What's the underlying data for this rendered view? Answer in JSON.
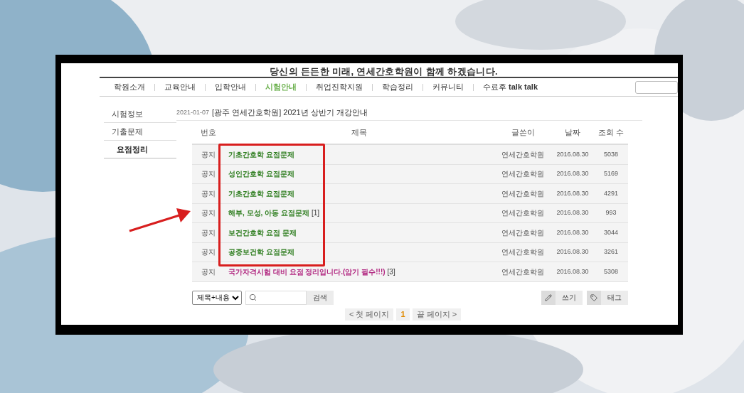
{
  "banner": {
    "slogan": "당신의 든든한 미래, 연세간호학원이 함께 하겠습니다."
  },
  "nav": [
    {
      "label": "학원소개",
      "selected": false
    },
    {
      "label": "교육안내",
      "selected": false
    },
    {
      "label": "입학안내",
      "selected": false
    },
    {
      "label": "시험안내",
      "selected": true
    },
    {
      "label": "취업진학지원",
      "selected": false
    },
    {
      "label": "학습정리",
      "selected": false
    },
    {
      "label": "커뮤니티",
      "selected": false
    },
    {
      "label": "수료후 **talk talk**",
      "selected": false
    }
  ],
  "sidebar": {
    "items": [
      {
        "label": "시험정보",
        "selected": false
      },
      {
        "label": "기출문제",
        "selected": false
      },
      {
        "label": "요점정리",
        "selected": true
      }
    ]
  },
  "notice": {
    "date": "2021-01-07",
    "title": "[광주 연세간호학원] 2021년 상반기 개강안내"
  },
  "table": {
    "columns": [
      "번호",
      "제목",
      "글쓴이",
      "날짜",
      "조회 수"
    ],
    "rows": [
      {
        "number": "공지",
        "title": "기초간호학 요점문제",
        "comments": "",
        "color": "#2e7d1f",
        "author": "연세간호학원",
        "date": "2016.08.30",
        "views": "5038"
      },
      {
        "number": "공지",
        "title": "성인간호학 요점문제",
        "comments": "",
        "color": "#2e7d1f",
        "author": "연세간호학원",
        "date": "2016.08.30",
        "views": "5169"
      },
      {
        "number": "공지",
        "title": "기초간호학 요점문제",
        "comments": "",
        "color": "#2e7d1f",
        "author": "연세간호학원",
        "date": "2016.08.30",
        "views": "4291"
      },
      {
        "number": "공지",
        "title": "해부, 모성, 아동 요점문제",
        "comments": "[1]",
        "color": "#2e7d1f",
        "author": "연세간호학원",
        "date": "2016.08.30",
        "views": "993"
      },
      {
        "number": "공지",
        "title": "보건간호학 요점 문제",
        "comments": "",
        "color": "#2e7d1f",
        "author": "연세간호학원",
        "date": "2016.08.30",
        "views": "3044"
      },
      {
        "number": "공지",
        "title": "공중보건학 요점문제",
        "comments": "",
        "color": "#2e7d1f",
        "author": "연세간호학원",
        "date": "2016.08.30",
        "views": "3261"
      },
      {
        "number": "공지",
        "title": "국가자격시험 대비 요점 정리입니다.(암기 필수!!!)",
        "comments": "[3]",
        "color": "#b0247f",
        "author": "연세간호학원",
        "date": "2016.08.30",
        "views": "5308"
      }
    ]
  },
  "search": {
    "scope": "제목+내용",
    "button": "검색"
  },
  "actions": [
    "쓰기",
    "태그"
  ],
  "pagination": {
    "first": "< 첫 페이지",
    "pages": [
      {
        "label": "1",
        "selected": true
      }
    ],
    "last": "끝 페이지 >"
  }
}
